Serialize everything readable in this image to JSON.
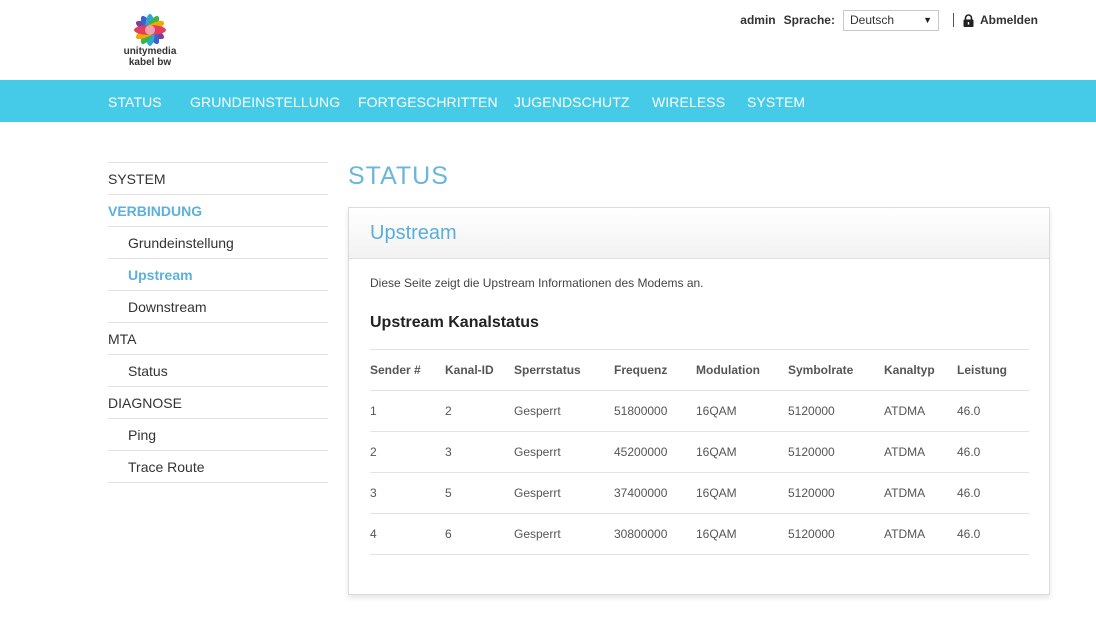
{
  "brand": {
    "line1": "unitymedia",
    "line2": "kabel bw"
  },
  "topbar": {
    "user": "admin",
    "language_label": "Sprache:",
    "language_value": "Deutsch",
    "logout_label": "Abmelden",
    "logout_icon": "lock-icon"
  },
  "nav": {
    "items": [
      {
        "label": "STATUS"
      },
      {
        "label": "GRUNDEINSTELLUNG"
      },
      {
        "label": "FORTGESCHRITTEN"
      },
      {
        "label": "JUGENDSCHUTZ"
      },
      {
        "label": "WIRELESS"
      },
      {
        "label": "SYSTEM"
      }
    ]
  },
  "sidebar": {
    "items": [
      {
        "label": "SYSTEM"
      },
      {
        "label": "VERBINDUNG"
      },
      {
        "label": "Grundeinstellung"
      },
      {
        "label": "Upstream"
      },
      {
        "label": "Downstream"
      },
      {
        "label": "MTA"
      },
      {
        "label": "Status"
      },
      {
        "label": "DIAGNOSE"
      },
      {
        "label": "Ping"
      },
      {
        "label": "Trace Route"
      }
    ]
  },
  "main": {
    "page_title": "STATUS",
    "panel_title": "Upstream",
    "description": "Diese Seite zeigt die Upstream Informationen des Modems an.",
    "section_title": "Upstream Kanalstatus",
    "table": {
      "headers": [
        "Sender #",
        "Kanal-ID",
        "Sperrstatus",
        "Frequenz",
        "Modulation",
        "Symbolrate",
        "Kanaltyp",
        "Leistung"
      ],
      "rows": [
        [
          "1",
          "2",
          "Gesperrt",
          "51800000",
          "16QAM",
          "5120000",
          "ATDMA",
          "46.0"
        ],
        [
          "2",
          "3",
          "Gesperrt",
          "45200000",
          "16QAM",
          "5120000",
          "ATDMA",
          "46.0"
        ],
        [
          "3",
          "5",
          "Gesperrt",
          "37400000",
          "16QAM",
          "5120000",
          "ATDMA",
          "46.0"
        ],
        [
          "4",
          "6",
          "Gesperrt",
          "30800000",
          "16QAM",
          "5120000",
          "ATDMA",
          "46.0"
        ]
      ]
    }
  },
  "colors": {
    "nav_bg": "#45cbe8",
    "accent": "#5db0dc"
  }
}
